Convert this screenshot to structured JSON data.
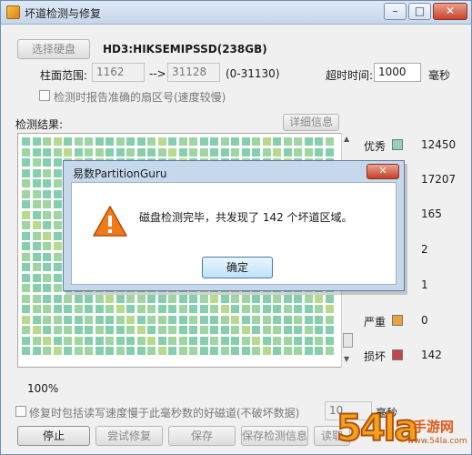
{
  "window": {
    "title": "坏道检测与修复",
    "min_glyph": "–",
    "max_glyph": "□",
    "close_glyph": "✕"
  },
  "top": {
    "select_disk_button": "选择硬盘",
    "disk_name": "HD3:HIKSEMIPSSD(238GB)",
    "cylinder_label": "柱面范围:",
    "cylinder_start": "1162",
    "arrow": "-->",
    "cylinder_end": "31128",
    "cylinder_range": "(0-31130)",
    "timeout_label": "超时时间:",
    "timeout_value": "1000",
    "timeout_unit": "毫秒",
    "report_checkbox_label": "检测时报告准确的扇区号(速度较慢)"
  },
  "results": {
    "label": "检测结果:",
    "details_button": "详细信息",
    "progress_text": "100%"
  },
  "legend": [
    {
      "label": "优秀",
      "count": "12450",
      "color": "#8fd3b6"
    },
    {
      "label": "",
      "count": "17207",
      "color": "#9cd6a3"
    },
    {
      "label": "",
      "count": "165",
      "color": "#c7d77a"
    },
    {
      "label": "",
      "count": "2",
      "color": "#e0c766"
    },
    {
      "label": "",
      "count": "1",
      "color": "#e8b85c"
    },
    {
      "label": "严重",
      "count": "0",
      "color": "#e8a23e"
    },
    {
      "label": "损坏",
      "count": "142",
      "color": "#c0484b"
    }
  ],
  "grid_colors": {
    "excellent": "#86cfae",
    "good": "#9ed5a1",
    "fair": "#b9d98c"
  },
  "bottom": {
    "repair_checkbox_label": "修复时包括读写速度慢于此毫秒数的好磁道(不破坏数据)",
    "ms_value": "10",
    "ms_unit": "毫秒",
    "stop_button": "停止",
    "try_repair_button": "尝试修复",
    "save_button": "保存",
    "save_info_button": "保存检测信息",
    "read_info_button": "读取"
  },
  "dialog": {
    "title": "易数PartitionGuru",
    "close_glyph": "✕",
    "message": "磁盘检测完毕，共发现了 142 个坏道区域。",
    "ok_button": "确定"
  },
  "watermark": {
    "big": "54la",
    "small": "手游网",
    "url": "www.54la.com"
  }
}
